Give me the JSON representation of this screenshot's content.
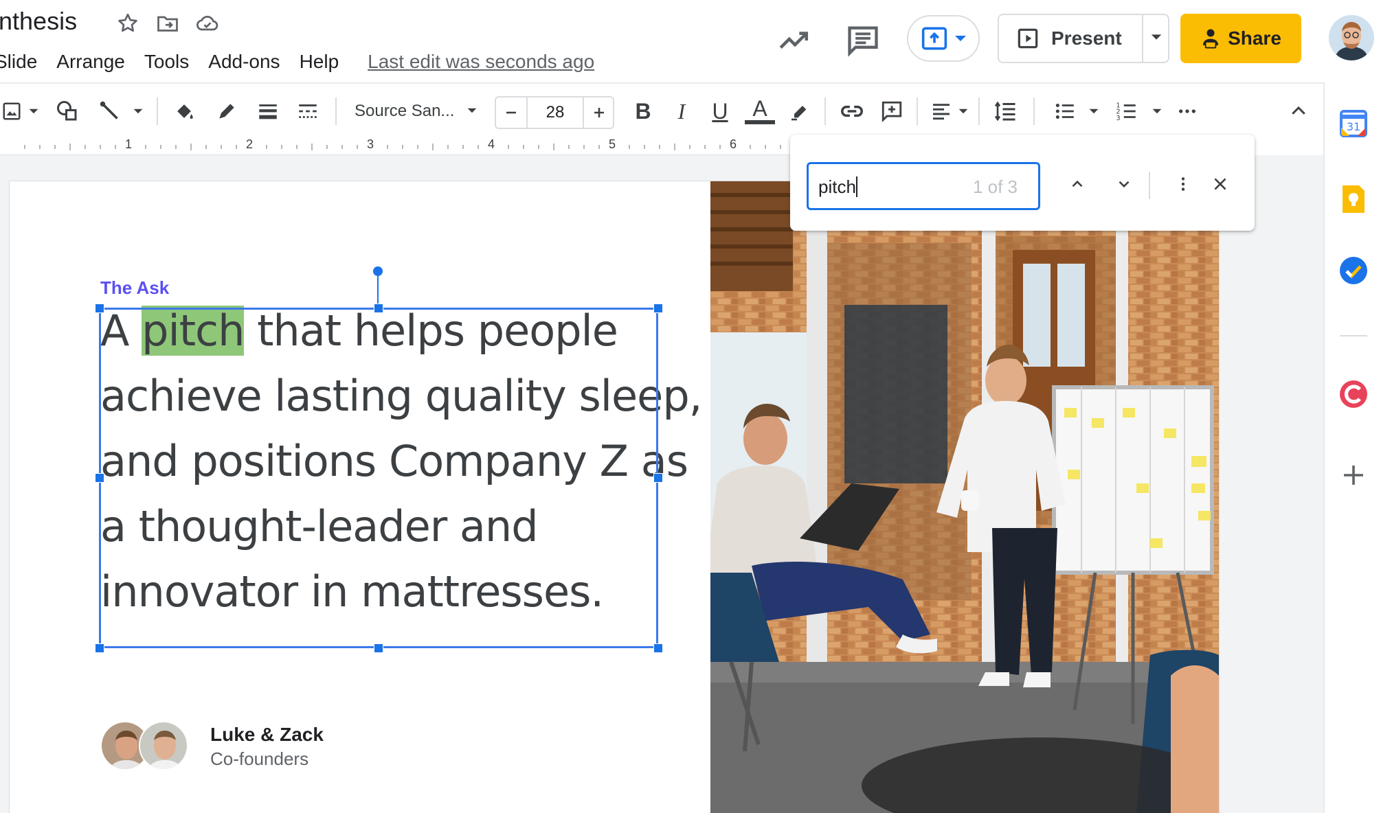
{
  "app": {
    "title": "nthesis",
    "menu": [
      "Slide",
      "Arrange",
      "Tools",
      "Add-ons",
      "Help"
    ],
    "last_edit": "Last edit was seconds ago"
  },
  "header": {
    "present_label": "Present",
    "share_label": "Share"
  },
  "toolbar": {
    "font_name": "Source San...",
    "font_size": "28",
    "bold": "B",
    "italic": "I",
    "underline": "U",
    "text_color": "A"
  },
  "ruler": {
    "marks": [
      "1",
      "2",
      "3",
      "4",
      "5",
      "6"
    ]
  },
  "find": {
    "query": "pitch",
    "count": "1 of 3"
  },
  "slide": {
    "eyebrow": "The Ask",
    "body": {
      "line1_a": "A ",
      "line1_hit": "pitch",
      "line1_b": " that helps people",
      "line2": "achieve lasting quality sleep,",
      "line3": "and positions Company Z as",
      "line4": "a thought-leader and",
      "line5": "innovator in mattresses."
    },
    "founders": {
      "name": "Luke & Zack",
      "role": "Co-founders"
    }
  },
  "colors": {
    "accent_purple": "#5b50f0",
    "selection_blue": "#1a73e8",
    "find_highlight": "#8fc779",
    "share_yellow": "#fbbc04"
  },
  "icons": {
    "title": [
      "star-icon",
      "move-to-folder-icon",
      "cloud-saved-icon"
    ],
    "header": [
      "activity-trend-icon",
      "comments-icon",
      "meet-present-icon",
      "present-slideshow-icon"
    ],
    "side_panel": [
      "google-calendar-icon",
      "google-keep-icon",
      "google-tasks-icon",
      "addon-icon",
      "add-icon"
    ]
  }
}
